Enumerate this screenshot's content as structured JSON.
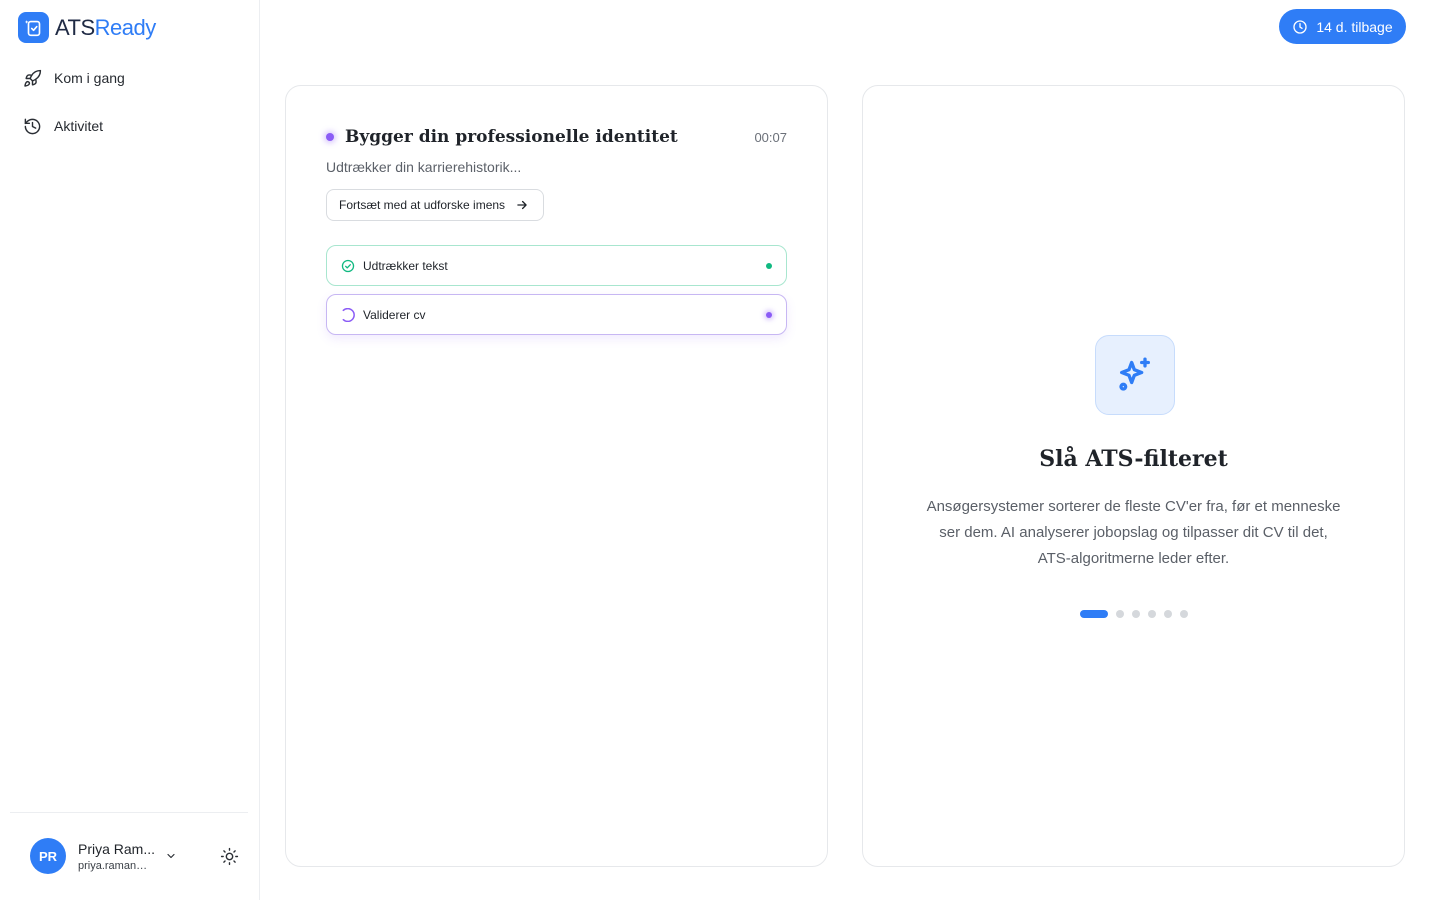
{
  "brand": {
    "name_part1": "ATS",
    "name_part2": "Ready",
    "accent_color": "#2f7df6"
  },
  "nav": {
    "items": [
      {
        "label": "Kom i gang",
        "icon": "rocket-icon"
      },
      {
        "label": "Aktivitet",
        "icon": "history-icon"
      }
    ]
  },
  "user": {
    "initials": "PR",
    "name": "Priya Ram...",
    "email": "priya.raman@..."
  },
  "trial": {
    "label": "14 d. tilbage",
    "icon": "clock-icon"
  },
  "progress": {
    "title": "Bygger din professionelle identitet",
    "timer": "00:07",
    "subtitle": "Udtrækker din karrierehistorik...",
    "continue_label": "Fortsæt med at udforske imens",
    "steps": [
      {
        "label": "Udtrækker tekst",
        "status": "done",
        "status_color": "#10b981"
      },
      {
        "label": "Validerer cv",
        "status": "in-progress",
        "status_color": "#8b5cf6"
      }
    ]
  },
  "tip": {
    "icon": "sparkles-icon",
    "title": "Slå ATS-filteret",
    "text": "Ansøgersystemer sorterer de fleste CV'er fra, før et menneske ser dem. AI analyserer jobopslag og tilpasser dit CV til det, ATS-algoritmerne leder efter.",
    "carousel_total": 6,
    "carousel_active": 1
  }
}
